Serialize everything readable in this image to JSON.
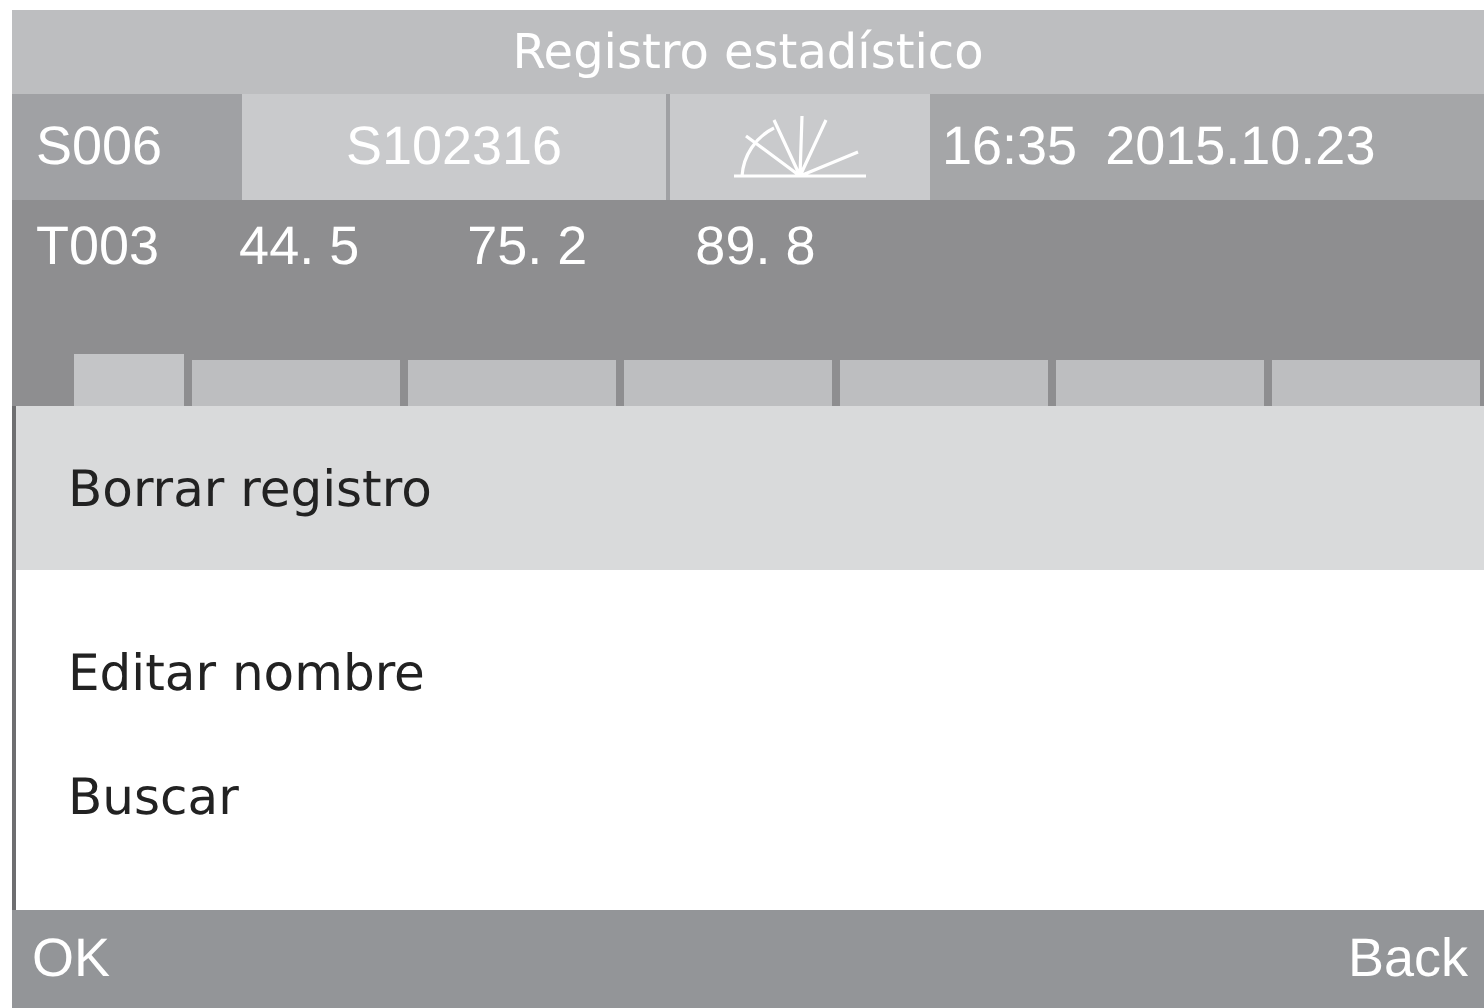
{
  "window": {
    "title": "Registro estadístico"
  },
  "info_row": {
    "sample_no": "S006",
    "sample_name": "S102316",
    "time": "16:35",
    "date": "2015.10.23"
  },
  "test_row": {
    "test_no": "T003",
    "values": [
      "44. 5",
      "75. 2",
      "89. 8"
    ]
  },
  "menu": {
    "items": [
      {
        "label": "Borrar registro",
        "selected": true
      },
      {
        "label": "Editar nombre",
        "selected": false
      },
      {
        "label": "Buscar",
        "selected": false
      }
    ]
  },
  "softkeys": {
    "left": "OK",
    "right": "Back"
  }
}
